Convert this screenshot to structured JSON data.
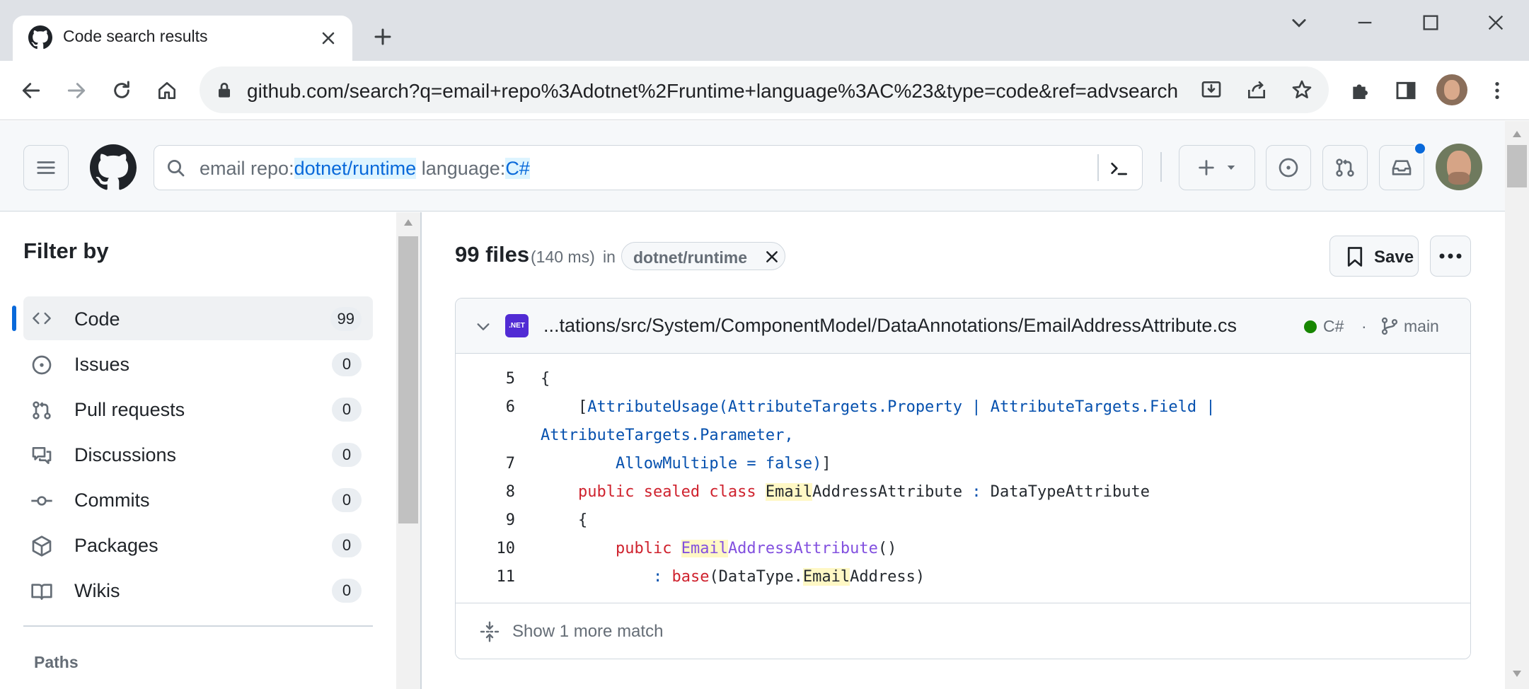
{
  "browser": {
    "tab_title": "Code search results",
    "url": "github.com/search?q=email+repo%3Adotnet%2Fruntime+language%3AC%23&type=code&ref=advsearch"
  },
  "search": {
    "term": "email ",
    "repo_key": "repo:",
    "repo_value": "dotnet/runtime",
    "lang_key": " language:",
    "lang_value": "C#"
  },
  "sidebar": {
    "title": "Filter by",
    "items": [
      {
        "label": "Code",
        "count": "99",
        "icon": "code-icon"
      },
      {
        "label": "Issues",
        "count": "0",
        "icon": "issue-icon"
      },
      {
        "label": "Pull requests",
        "count": "0",
        "icon": "pull-request-icon"
      },
      {
        "label": "Discussions",
        "count": "0",
        "icon": "discussion-icon"
      },
      {
        "label": "Commits",
        "count": "0",
        "icon": "commit-icon"
      },
      {
        "label": "Packages",
        "count": "0",
        "icon": "package-icon"
      },
      {
        "label": "Wikis",
        "count": "0",
        "icon": "book-icon"
      }
    ],
    "paths_label": "Paths"
  },
  "results": {
    "count": "99 files",
    "time": "(140 ms)",
    "in_label": "in",
    "repo_chip": "dotnet/runtime",
    "save_label": "Save"
  },
  "result": {
    "badge": ".NET",
    "path": "...tations/src/System/ComponentModel/DataAnnotations/EmailAddressAttribute.cs",
    "language": "C#",
    "language_color": "#178600",
    "separator": "·",
    "branch": "main",
    "line_numbers": [
      "5",
      "6",
      "7",
      "8",
      "9",
      "10",
      "11"
    ],
    "more_match": "Show 1 more match"
  },
  "colors": {
    "accent": "#0969da",
    "keyword": "#cf222e",
    "function": "#8250df",
    "type": "#0550ae",
    "highlight": "#fff8c5"
  }
}
